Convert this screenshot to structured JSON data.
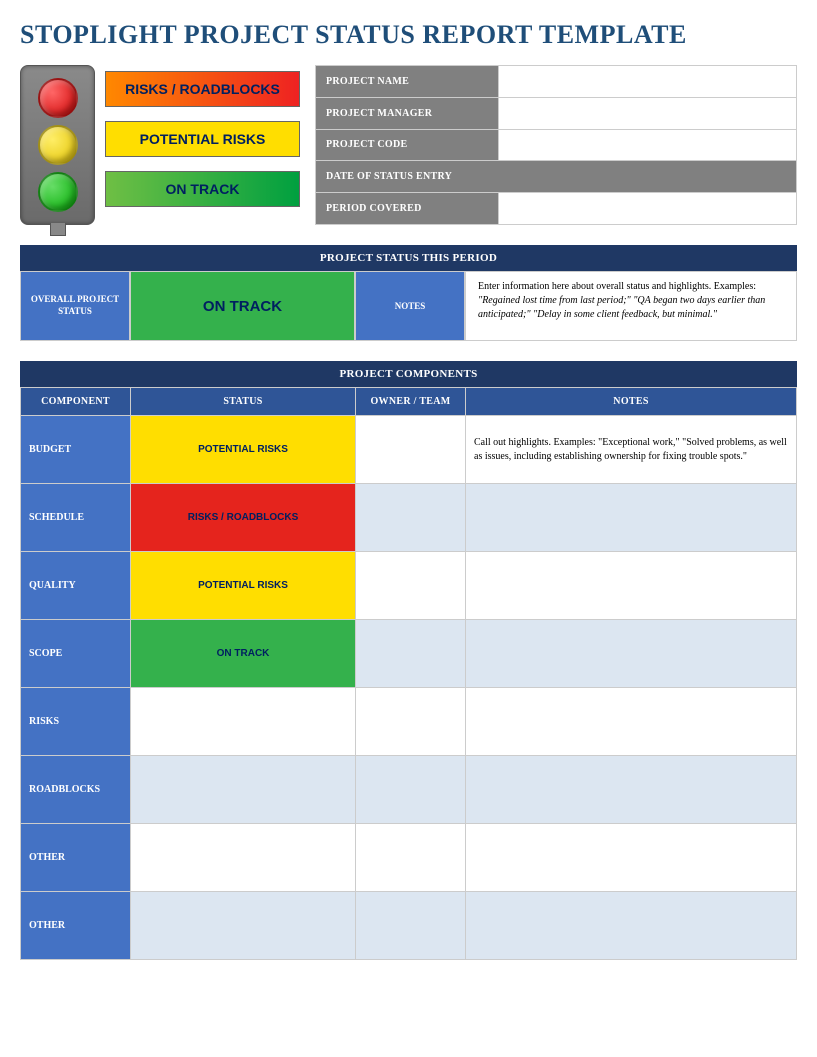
{
  "title": "STOPLIGHT PROJECT STATUS REPORT TEMPLATE",
  "legend": {
    "red": "RISKS / ROADBLOCKS",
    "yellow": "POTENTIAL RISKS",
    "green": "ON TRACK"
  },
  "meta": {
    "project_name_label": "PROJECT NAME",
    "project_name_value": "",
    "project_manager_label": "PROJECT MANAGER",
    "project_manager_value": "",
    "project_code_label": "PROJECT CODE",
    "project_code_value": "",
    "date_label": "DATE OF STATUS ENTRY",
    "period_label": "PERIOD COVERED",
    "period_value": ""
  },
  "status_section": {
    "header": "PROJECT STATUS THIS PERIOD",
    "overall_label": "OVERALL PROJECT STATUS",
    "overall_status": "ON TRACK",
    "overall_status_color": "green",
    "notes_label": "NOTES",
    "notes_lead": "Enter information here about overall status and highlights. Examples:",
    "notes_examples": "\"Regained lost time from last period;\" \"QA began two days earlier than anticipated;\" \"Delay in some client feedback, but minimal.\""
  },
  "components_section": {
    "header": "PROJECT COMPONENTS",
    "columns": {
      "component": "COMPONENT",
      "status": "STATUS",
      "owner": "OWNER / TEAM",
      "notes": "NOTES"
    },
    "rows": [
      {
        "component": "BUDGET",
        "status": "POTENTIAL RISKS",
        "color": "yellow",
        "owner": "",
        "notes": "Call out highlights. Examples: \"Exceptional work,\" \"Solved problems, as well as issues, including establishing ownership for fixing trouble spots.\"",
        "alt": false
      },
      {
        "component": "SCHEDULE",
        "status": "RISKS / ROADBLOCKS",
        "color": "red",
        "owner": "",
        "notes": "",
        "alt": true
      },
      {
        "component": "QUALITY",
        "status": "POTENTIAL RISKS",
        "color": "yellow",
        "owner": "",
        "notes": "",
        "alt": false
      },
      {
        "component": "SCOPE",
        "status": "ON TRACK",
        "color": "green",
        "owner": "",
        "notes": "",
        "alt": true
      },
      {
        "component": "RISKS",
        "status": "",
        "color": "",
        "owner": "",
        "notes": "",
        "alt": false
      },
      {
        "component": "ROADBLOCKS",
        "status": "",
        "color": "",
        "owner": "",
        "notes": "",
        "alt": true
      },
      {
        "component": "OTHER",
        "status": "",
        "color": "",
        "owner": "",
        "notes": "",
        "alt": false
      },
      {
        "component": "OTHER",
        "status": "",
        "color": "",
        "owner": "",
        "notes": "",
        "alt": true
      }
    ]
  }
}
